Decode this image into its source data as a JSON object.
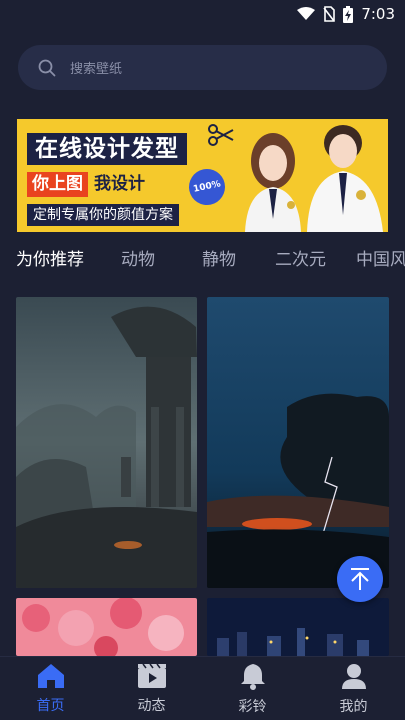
{
  "status": {
    "time": "7:03"
  },
  "search": {
    "placeholder": "搜索壁纸"
  },
  "banner": {
    "line1": "在线设计发型",
    "line2a": "你上图",
    "line2b": "我设计",
    "line3": "定制专属你的颜值方案",
    "badge": "100%"
  },
  "tabs": [
    "为你推荐",
    "动物",
    "静物",
    "二次元",
    "中国风"
  ],
  "nav": [
    {
      "label": "首页",
      "icon": "home-icon"
    },
    {
      "label": "动态",
      "icon": "video-icon"
    },
    {
      "label": "彩铃",
      "icon": "bell-icon"
    },
    {
      "label": "我的",
      "icon": "user-icon"
    }
  ],
  "colors": {
    "background": "#1c2033",
    "accent": "#3a6cf5",
    "banner": "#f5c92c"
  }
}
